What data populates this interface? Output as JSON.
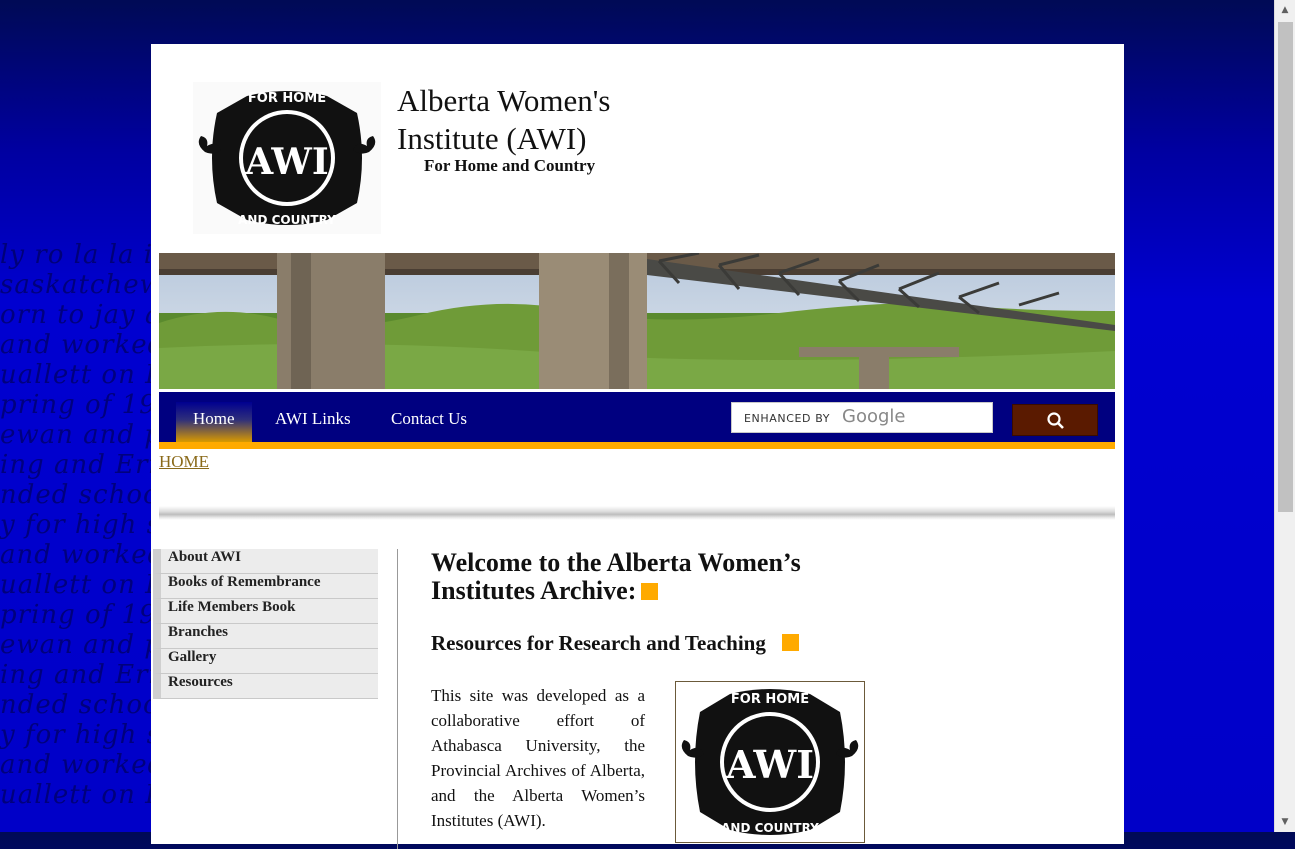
{
  "site": {
    "title": "Alberta Women's Institute (AWI)",
    "tagline": "For Home and Country",
    "logo_text_top": "FOR HOME",
    "logo_text_bottom": "AND COUNTRY",
    "logo_monogram": "AWI"
  },
  "nav": {
    "items": [
      {
        "label": "Home",
        "active": true
      },
      {
        "label": "AWI Links",
        "active": false
      },
      {
        "label": "Contact Us",
        "active": false
      }
    ]
  },
  "search": {
    "placeholder_prefix": "ENHANCED BY",
    "brand": "Google",
    "button_icon": "search-icon"
  },
  "breadcrumb": "HOME",
  "sidebar": {
    "items": [
      {
        "label": "About AWI"
      },
      {
        "label": "Books of Remembrance"
      },
      {
        "label": "Life Members Book"
      },
      {
        "label": "Branches"
      },
      {
        "label": "Gallery"
      },
      {
        "label": "Resources"
      }
    ]
  },
  "main": {
    "heading": "Welcome to the Alberta Women’s Institutes Archive:",
    "subheading": "Resources for Research and Teaching",
    "intro": "This site was developed as a collaborative effort of Athabasca University, the Provincial Archives of Alberta, and the Alberta Women’s Institutes (AWI)."
  },
  "colors": {
    "nav_bg": "#000080",
    "accent": "#ffaa00",
    "search_button": "#5a1a00",
    "breadcrumb": "#8a6a1a"
  }
}
